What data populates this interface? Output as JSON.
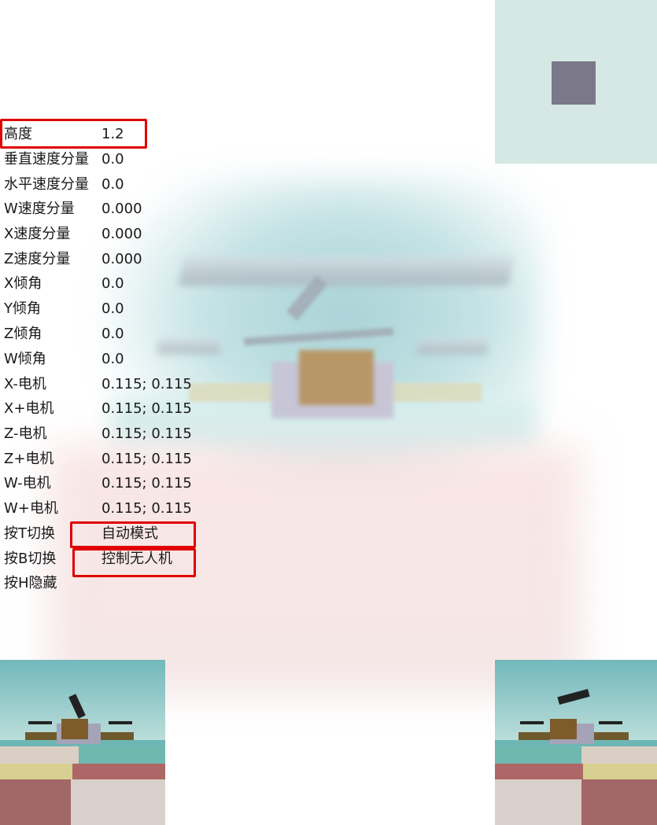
{
  "hud": {
    "rows": [
      {
        "label": "高度",
        "value": "1.2"
      },
      {
        "label": "垂直速度分量",
        "value": "0.0"
      },
      {
        "label": "水平速度分量",
        "value": "0.0"
      },
      {
        "label": "W速度分量",
        "value": "0.000"
      },
      {
        "label": "X速度分量",
        "value": "0.000"
      },
      {
        "label": "Z速度分量",
        "value": "0.000"
      },
      {
        "label": "X倾角",
        "value": "0.0"
      },
      {
        "label": "Y倾角",
        "value": "0.0"
      },
      {
        "label": "Z倾角",
        "value": "0.0"
      },
      {
        "label": "W倾角",
        "value": "0.0"
      },
      {
        "label": "X-电机",
        "value": "0.115; 0.115"
      },
      {
        "label": "X+电机",
        "value": "0.115; 0.115"
      },
      {
        "label": "Z-电机",
        "value": "0.115; 0.115"
      },
      {
        "label": "Z+电机",
        "value": "0.115; 0.115"
      },
      {
        "label": "W-电机",
        "value": "0.115; 0.115"
      },
      {
        "label": "W+电机",
        "value": "0.115; 0.115"
      },
      {
        "label": "按T切换",
        "value": "自动模式"
      },
      {
        "label": "按B切换",
        "value": "控制无人机"
      },
      {
        "label": "按H隐藏",
        "value": ""
      }
    ]
  },
  "colors": {
    "highlight": "#e00000",
    "minimap_bg": "#d5e8e3",
    "minimap_marker": "#7b7989",
    "text": "#1a1a1a"
  },
  "icons": {
    "minimap_marker": "drone-marker-icon"
  }
}
